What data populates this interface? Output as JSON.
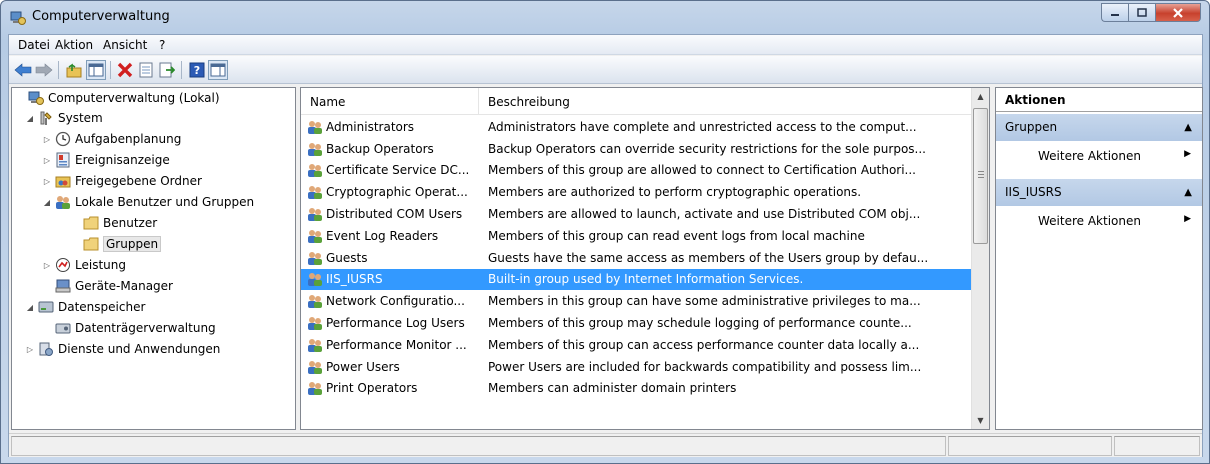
{
  "window": {
    "title": "Computerverwaltung",
    "buttons": [
      "minimize",
      "maximize",
      "close"
    ]
  },
  "menu": [
    "Datei",
    "Aktion",
    "Ansicht",
    "?"
  ],
  "toolbar": {
    "icons": [
      "back-icon",
      "forward-icon",
      "up-folder-icon",
      "show-hide-tree-icon",
      "delete-icon",
      "properties-icon",
      "export-list-icon",
      "help-icon",
      "show-hide-action-pane-icon"
    ]
  },
  "tree": {
    "items": [
      {
        "label": "Computerverwaltung (Lokal)",
        "expander": "",
        "icon": "computer-management-icon"
      },
      {
        "label": "System",
        "expander": "◢",
        "icon": "system-tools-icon"
      },
      {
        "label": "Aufgabenplanung",
        "expander": "▷",
        "icon": "task-scheduler-icon"
      },
      {
        "label": "Ereignisanzeige",
        "expander": "▷",
        "icon": "event-viewer-icon"
      },
      {
        "label": "Freigegebene Ordner",
        "expander": "▷",
        "icon": "shared-folders-icon"
      },
      {
        "label": "Lokale Benutzer und Gruppen",
        "expander": "◢",
        "icon": "users-groups-icon"
      },
      {
        "label": "Benutzer",
        "expander": "",
        "icon": "folder-icon"
      },
      {
        "label": "Gruppen",
        "expander": "",
        "icon": "folder-icon"
      },
      {
        "label": "Leistung",
        "expander": "▷",
        "icon": "performance-icon"
      },
      {
        "label": "Geräte-Manager",
        "expander": "",
        "icon": "device-manager-icon"
      },
      {
        "label": "Datenspeicher",
        "expander": "◢",
        "icon": "storage-icon"
      },
      {
        "label": "Datenträgerverwaltung",
        "expander": "",
        "icon": "disk-management-icon"
      },
      {
        "label": "Dienste und Anwendungen",
        "expander": "▷",
        "icon": "services-applications-icon"
      }
    ],
    "selected": "Gruppen"
  },
  "list": {
    "columns": [
      "Name",
      "Beschreibung"
    ],
    "rows": [
      {
        "name": "Administrators",
        "desc": "Administrators have complete and unrestricted access to the comput..."
      },
      {
        "name": "Backup Operators",
        "desc": "Backup Operators can override security restrictions for the sole purpos..."
      },
      {
        "name": "Certificate Service DC...",
        "desc": "Members of this group are allowed to connect to Certification Authori..."
      },
      {
        "name": "Cryptographic Operat...",
        "desc": "Members are authorized to perform cryptographic operations."
      },
      {
        "name": "Distributed COM Users",
        "desc": "Members are allowed to launch, activate and use Distributed COM obj..."
      },
      {
        "name": "Event Log Readers",
        "desc": "Members of this group can read event logs from local machine"
      },
      {
        "name": "Guests",
        "desc": "Guests have the same access as members of the Users group by defau..."
      },
      {
        "name": "IIS_IUSRS",
        "desc": "Built-in group used by Internet Information Services."
      },
      {
        "name": "Network Configuratio...",
        "desc": "Members in this group can have some administrative privileges to ma..."
      },
      {
        "name": "Performance Log Users",
        "desc": "Members of this group may schedule logging of performance counte..."
      },
      {
        "name": "Performance Monitor ...",
        "desc": "Members of this group can access performance counter data locally a..."
      },
      {
        "name": "Power Users",
        "desc": "Power Users are included for backwards compatibility and possess lim..."
      },
      {
        "name": "Print Operators",
        "desc": "Members can administer domain printers"
      }
    ],
    "selected_row": "IIS_IUSRS"
  },
  "actions": {
    "title": "Aktionen",
    "groups": [
      {
        "label": "Gruppen",
        "item": "Weitere Aktionen"
      },
      {
        "label": "IIS_IUSRS",
        "item": "Weitere Aktionen"
      }
    ]
  },
  "colors": {
    "selection": "#3399ff",
    "action_header": "#b9cde6",
    "window_frame": "#b9cde6"
  }
}
